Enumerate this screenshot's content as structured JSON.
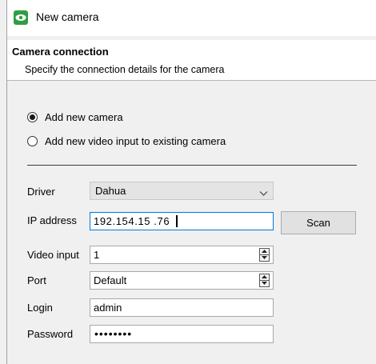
{
  "window": {
    "title": "New camera",
    "icon": "eye-icon"
  },
  "header": {
    "title": "Camera connection",
    "subtitle": "Specify the connection details for the camera"
  },
  "connection_mode": {
    "options": [
      {
        "label": "Add new camera",
        "selected": true
      },
      {
        "label": "Add new video input to existing camera",
        "selected": false
      }
    ]
  },
  "form": {
    "driver": {
      "label": "Driver",
      "value": "Dahua"
    },
    "ip_address": {
      "label": "IP address",
      "value": "192.154.15 .76"
    },
    "scan_button": {
      "label": "Scan"
    },
    "video_input": {
      "label": "Video input",
      "value": "1"
    },
    "port": {
      "label": "Port",
      "value": "Default"
    },
    "login": {
      "label": "Login",
      "value": "admin"
    },
    "password": {
      "label": "Password",
      "value": "••••••••"
    }
  }
}
